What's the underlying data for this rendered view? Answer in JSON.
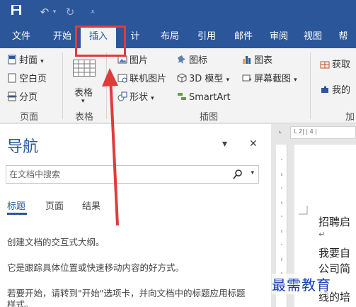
{
  "tabs": [
    "文件",
    "开始",
    "插入",
    "设计",
    "布局",
    "引用",
    "邮件",
    "审阅",
    "视图",
    "帮"
  ],
  "tab_visible": [
    "文件",
    "开始",
    "插入",
    "计",
    "布局",
    "引用",
    "邮件",
    "审阅",
    "视图",
    "帮"
  ],
  "active_tab": "插入",
  "ribbon": {
    "pages": {
      "cover": "封面",
      "blank": "空白页",
      "break": "分页",
      "label": "页面"
    },
    "table": {
      "button": "表格",
      "label": "表格"
    },
    "illustrations": {
      "picture": "图片",
      "online_picture": "联机图片",
      "shapes": "形状",
      "icons": "图标",
      "model3d": "3D 模型",
      "smartart": "SmartArt",
      "chart": "图表",
      "screenshot": "屏幕截图",
      "label": "插图"
    },
    "addins": {
      "get": "获取",
      "my": "我的",
      "label": "加"
    }
  },
  "nav": {
    "title": "导航",
    "search_placeholder": "在文档中搜索",
    "tabs": [
      "标题",
      "页面",
      "结果"
    ],
    "text1": "创建文档的交互式大纲。",
    "text2": "它是跟踪具体位置或快速移动内容的好方式。",
    "text3a": "若要开始，请转到\"开始\"选项卡，并向文档中的标题应用标题",
    "text3b": "样式。"
  },
  "document": {
    "line1": "招聘启",
    "return_mark": "↵",
    "line2": "我要自",
    "line3": "公司简",
    "line4": "线的培"
  },
  "ruler": {
    "marks": "L 2| | 4 |"
  },
  "watermark": "最需教育",
  "colors": {
    "accent": "#2b579a",
    "highlight": "#e03b3b"
  }
}
